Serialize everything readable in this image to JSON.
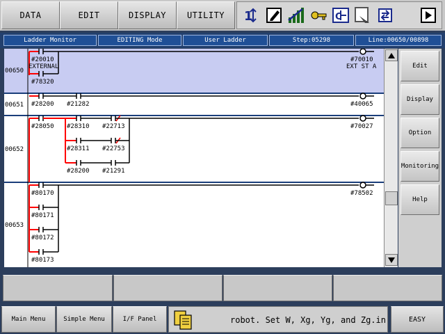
{
  "menu": {
    "data": "DATA",
    "edit": "EDIT",
    "display": "DISPLAY",
    "utility": "UTILITY"
  },
  "status": {
    "monitor": "Ladder Monitor",
    "mode": "EDITING Mode",
    "ladder": "User Ladder",
    "step": "Step:05298",
    "line": "Line:00650/00898"
  },
  "rungs": {
    "r650": "00650",
    "r651": "00651",
    "r652": "00652",
    "r653": "00653"
  },
  "ladder": {
    "c650a": "#20010",
    "c650b_label": "EXTERNAL",
    "c650c": "#78320",
    "o650": "#70010",
    "o650_label": "EXT ST A",
    "c651a": "#28200",
    "c651b": "#21282",
    "o651": "#40065",
    "c652a": "#28050",
    "c652b": "#28310",
    "c652c": "#22713",
    "c652d": "#28311",
    "c652e": "#22753",
    "c652f": "#28200",
    "c652g": "#21291",
    "o652": "#70027",
    "c653a": "#80170",
    "c653b": "#80171",
    "c653c": "#80172",
    "c653d": "#80173",
    "o653": "#78502"
  },
  "right_buttons": {
    "edit": "Edit",
    "display": "Display",
    "option": "Option",
    "monitoring": "Monitoring",
    "help": "Help"
  },
  "bottom": {
    "main_menu": "Main Menu",
    "simple_menu": "Simple Menu",
    "if_panel": "I/F Panel",
    "message": "robot. Set W, Xg, Yg, and Zg.in",
    "easy": "EASY"
  },
  "colors": {
    "highlight": "#c8ccf2",
    "active_rail": "#ff0000",
    "status_bg": "#1f4f96"
  }
}
